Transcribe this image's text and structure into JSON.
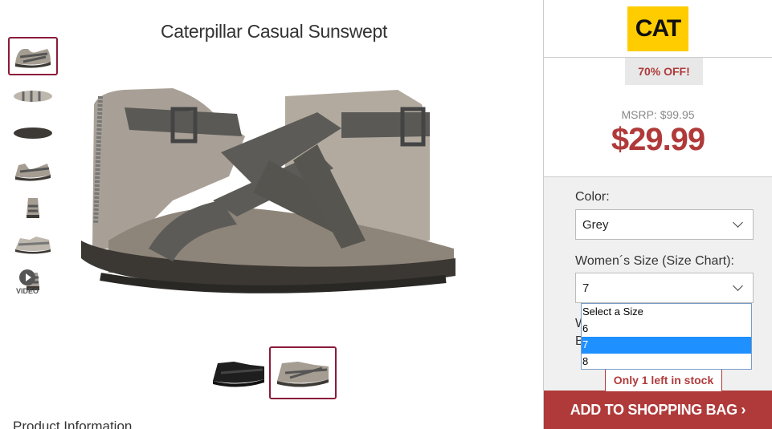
{
  "product": {
    "title": "Caterpillar Casual Sunswept",
    "info_heading": "Product Information"
  },
  "thumbnails": [
    {
      "label": "side-view",
      "selected": true
    },
    {
      "label": "top-view",
      "selected": false
    },
    {
      "label": "sole-view",
      "selected": false
    },
    {
      "label": "back-view",
      "selected": false
    },
    {
      "label": "front-view",
      "selected": false
    },
    {
      "label": "pair-view",
      "selected": false
    },
    {
      "label": "detail-view",
      "selected": false
    }
  ],
  "video": {
    "label": "VIDEO"
  },
  "swatches": [
    {
      "color": "black",
      "selected": false
    },
    {
      "color": "grey",
      "selected": true
    }
  ],
  "brand": {
    "logo_text": "CAT",
    "color": "#ffcc00"
  },
  "pricing": {
    "discount": "70% OFF!",
    "msrp": "MSRP: $99.95",
    "price": "$29.99",
    "accent": "#b03a3a"
  },
  "options": {
    "color_label": "Color:",
    "color_value": "Grey",
    "size_label_prefix": "Women´s Size (",
    "size_chart_link": "Size Chart",
    "size_label_suffix": "):",
    "size_value": "7",
    "hidden_w": "W",
    "hidden_b": "B",
    "size_options": [
      "Select a Size",
      "6",
      "7",
      "8"
    ],
    "highlighted_option": "7"
  },
  "stock": {
    "note": "Only 1 left in stock"
  },
  "cta": {
    "label": "ADD TO SHOPPING BAG ›"
  }
}
